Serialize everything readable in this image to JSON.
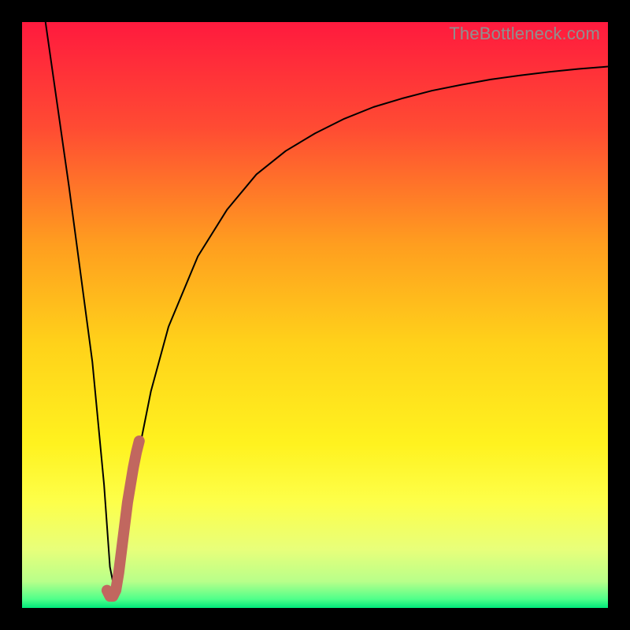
{
  "watermark": "TheBottleneck.com",
  "chart_data": {
    "type": "line",
    "title": "",
    "xlabel": "",
    "ylabel": "",
    "xlim": [
      0,
      100
    ],
    "ylim": [
      0,
      100
    ],
    "grid": false,
    "legend": false,
    "series": [
      {
        "name": "bottleneck-curve",
        "color": "#000000",
        "x": [
          4,
          6,
          8,
          10,
          12,
          14,
          15,
          16,
          17,
          18,
          20,
          22,
          25,
          30,
          35,
          40,
          45,
          50,
          55,
          60,
          65,
          70,
          75,
          80,
          85,
          90,
          95,
          100
        ],
        "values": [
          100,
          86,
          72,
          57,
          42,
          21,
          7,
          2,
          6,
          14,
          27,
          37,
          48,
          60,
          68,
          74,
          78,
          81,
          83.5,
          85.5,
          87,
          88.3,
          89.3,
          90.2,
          90.9,
          91.5,
          92,
          92.4
        ]
      },
      {
        "name": "optimal-range-highlight",
        "color": "#c1675f",
        "x": [
          14.5,
          15,
          15.5,
          16,
          16.5,
          17,
          17.5,
          18,
          18.5,
          19,
          19.5,
          20
        ],
        "values": [
          3,
          2,
          2,
          3,
          6,
          10,
          14,
          18,
          21,
          24,
          26.5,
          28.5
        ]
      }
    ],
    "background_gradient": {
      "stops": [
        {
          "offset": 0.0,
          "color": "#ff1a3e"
        },
        {
          "offset": 0.18,
          "color": "#ff4b33"
        },
        {
          "offset": 0.38,
          "color": "#ff9e1f"
        },
        {
          "offset": 0.55,
          "color": "#ffd21a"
        },
        {
          "offset": 0.72,
          "color": "#fff21f"
        },
        {
          "offset": 0.82,
          "color": "#fdff4a"
        },
        {
          "offset": 0.9,
          "color": "#e8ff7a"
        },
        {
          "offset": 0.955,
          "color": "#b8ff8a"
        },
        {
          "offset": 0.985,
          "color": "#4fff8a"
        },
        {
          "offset": 1.0,
          "color": "#00e87a"
        }
      ]
    }
  }
}
